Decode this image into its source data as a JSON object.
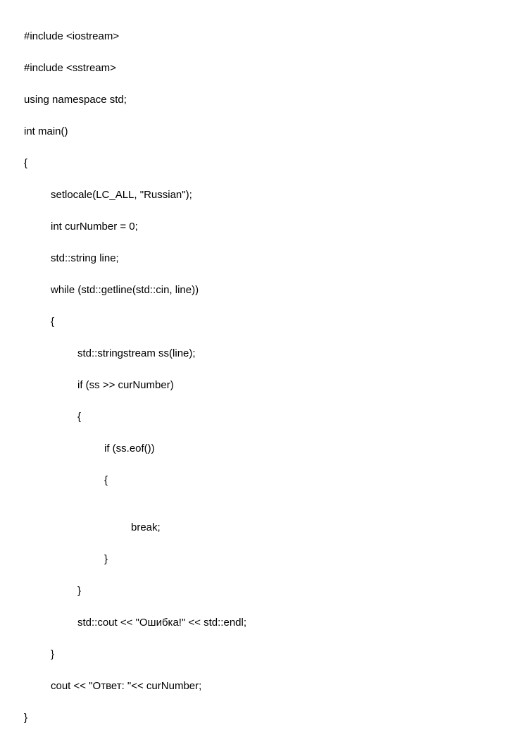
{
  "code": {
    "l1": "#include <iostream>",
    "l2": "#include <sstream>",
    "l3": "using namespace std;",
    "l4": "int main()",
    "l5": "{",
    "l6": "setlocale(LC_ALL, \"Russian\");",
    "l7": "int curNumber = 0;",
    "l8": "std::string line;",
    "l9": "while (std::getline(std::cin, line))",
    "l10": "{",
    "l11": "std::stringstream ss(line);",
    "l12": "if (ss >> curNumber)",
    "l13": "{",
    "l14": "if (ss.eof())",
    "l15": "{",
    "l16": "",
    "l17": "break;",
    "l18": "}",
    "l19": "}",
    "l20": "std::cout << \"Ошибка!\" << std::endl;",
    "l21": "}",
    "l22": "cout << \"Ответ: \"<< curNumber;",
    "l23": "}"
  }
}
